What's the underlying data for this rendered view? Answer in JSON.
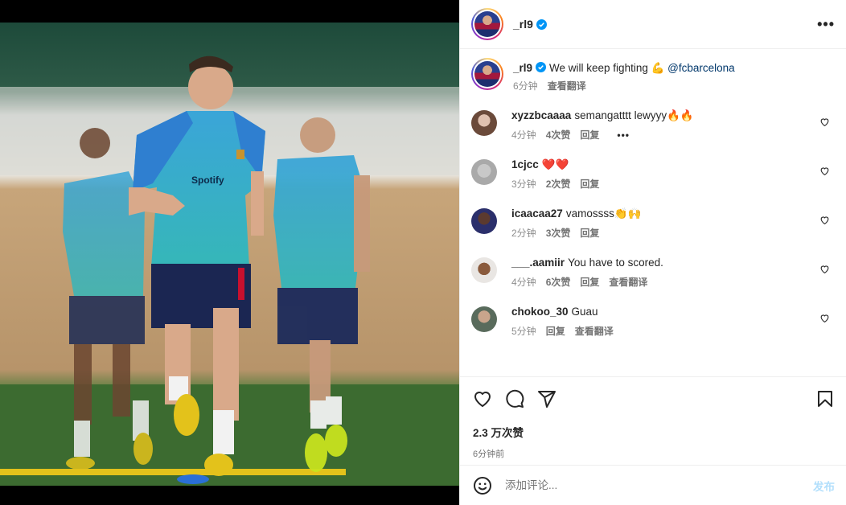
{
  "header": {
    "username": "_rl9",
    "more_label": "•••"
  },
  "caption": {
    "username": "_rl9",
    "text": "We will keep fighting 💪",
    "mention": "@fcbarcelona",
    "time": "6分钟",
    "translate": "查看翻译"
  },
  "comments": [
    {
      "username": "xyzzbcaaaa",
      "text": "semangatttt lewyyy🔥🔥",
      "time": "4分钟",
      "likes": "4次赞",
      "reply": "回复",
      "more": "•••"
    },
    {
      "username": "1cjcc",
      "text": "❤️❤️",
      "time": "3分钟",
      "likes": "2次赞",
      "reply": "回复"
    },
    {
      "username": "icaacaa27",
      "text": "vamossss👏🙌",
      "time": "2分钟",
      "likes": "3次赞",
      "reply": "回复"
    },
    {
      "username": "___.aamiir",
      "text": "You have to scored.",
      "time": "4分钟",
      "likes": "6次赞",
      "reply": "回复",
      "translate": "查看翻译"
    },
    {
      "username": "chokoo_30",
      "text": "Guau",
      "time": "5分钟",
      "reply": "回复",
      "translate": "查看翻译"
    }
  ],
  "actions": {
    "likes_count": "2.3 万次赞",
    "posted_time": "6分钟前"
  },
  "add_comment": {
    "placeholder": "添加评论...",
    "post_label": "发布"
  },
  "colors": {
    "link": "#00376b",
    "verified": "#0095f6",
    "post_disabled": "#b2dffc"
  }
}
